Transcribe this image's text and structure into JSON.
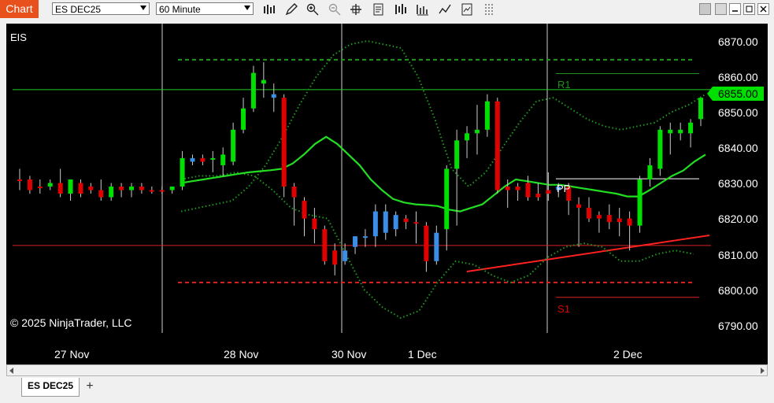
{
  "window": {
    "tab_label": "Chart"
  },
  "toolbar": {
    "instrument": "ES DEC25",
    "period": "60 Minute",
    "icons": [
      "bar-type-icon",
      "pencil-draw-icon",
      "zoom-in-icon",
      "zoom-out-icon",
      "crosshair-icon",
      "properties-icon",
      "data-series-icon",
      "strategies-icon",
      "indicators-icon",
      "chart-trader-icon",
      "templates-icon"
    ]
  },
  "chart": {
    "instrument_label": "EIS",
    "copyright": "© 2025 NinjaTrader, LLC",
    "price_axis": [
      "6870.00",
      "6860.00",
      "6850.00",
      "6840.00",
      "6830.00",
      "6820.00",
      "6810.00",
      "6800.00",
      "6790.00"
    ],
    "last_price": "6855.00",
    "date_labels": [
      "27 Nov",
      "28 Nov",
      "30 Nov",
      "1 Dec",
      "2 Dec"
    ],
    "pivot_labels": {
      "r1": "R1",
      "pp": "PP",
      "s1": "S1"
    },
    "colors": {
      "up": "#00e000",
      "down": "#e00000",
      "blue": "#3a8ee6",
      "sma": "#22dd22",
      "band": "#1f9a1f",
      "last_price_bg": "#00e000"
    }
  },
  "chart_data": {
    "type": "candlestick",
    "ylim": [
      6785,
      6875
    ],
    "bars": [
      {
        "o": 6831,
        "h": 6834,
        "l": 6828,
        "c": 6831,
        "col": "down"
      },
      {
        "o": 6831,
        "h": 6832,
        "l": 6827,
        "c": 6828,
        "col": "down"
      },
      {
        "o": 6829,
        "h": 6831,
        "l": 6827,
        "c": 6829,
        "col": "down"
      },
      {
        "o": 6829,
        "h": 6831,
        "l": 6828,
        "c": 6830,
        "col": "up"
      },
      {
        "o": 6830,
        "h": 6834,
        "l": 6826,
        "c": 6827,
        "col": "down"
      },
      {
        "o": 6827,
        "h": 6830,
        "l": 6825,
        "c": 6831,
        "col": "up"
      },
      {
        "o": 6830,
        "h": 6831,
        "l": 6826,
        "c": 6827,
        "col": "down"
      },
      {
        "o": 6829,
        "h": 6830,
        "l": 6827,
        "c": 6828,
        "col": "down"
      },
      {
        "o": 6828,
        "h": 6831,
        "l": 6825,
        "c": 6826,
        "col": "down"
      },
      {
        "o": 6826,
        "h": 6830,
        "l": 6825,
        "c": 6829,
        "col": "up"
      },
      {
        "o": 6828,
        "h": 6830,
        "l": 6826,
        "c": 6829,
        "col": "down"
      },
      {
        "o": 6828,
        "h": 6830,
        "l": 6826,
        "c": 6829,
        "col": "up"
      },
      {
        "o": 6829,
        "h": 6830,
        "l": 6827,
        "c": 6828,
        "col": "down"
      },
      {
        "o": 6828,
        "h": 6829,
        "l": 6827,
        "c": 6828,
        "col": "down"
      },
      {
        "o": 6828,
        "h": 6829,
        "l": 6827,
        "c": 6828,
        "col": "down"
      },
      {
        "o": 6828,
        "h": 6829,
        "l": 6827,
        "c": 6829,
        "col": "up"
      },
      {
        "o": 6829,
        "h": 6839,
        "l": 6828,
        "c": 6837,
        "col": "up"
      },
      {
        "o": 6837,
        "h": 6838,
        "l": 6835,
        "c": 6836,
        "col": "blue"
      },
      {
        "o": 6836,
        "h": 6838,
        "l": 6835,
        "c": 6837,
        "col": "down"
      },
      {
        "o": 6837,
        "h": 6839,
        "l": 6833,
        "c": 6837,
        "col": "up"
      },
      {
        "o": 6835,
        "h": 6840,
        "l": 6832,
        "c": 6838,
        "col": "up"
      },
      {
        "o": 6836,
        "h": 6847,
        "l": 6835,
        "c": 6845,
        "col": "up"
      },
      {
        "o": 6845,
        "h": 6854,
        "l": 6844,
        "c": 6851,
        "col": "up"
      },
      {
        "o": 6851,
        "h": 6863,
        "l": 6850,
        "c": 6861,
        "col": "up"
      },
      {
        "o": 6858,
        "h": 6864,
        "l": 6854,
        "c": 6859,
        "col": "up"
      },
      {
        "o": 6855,
        "h": 6858,
        "l": 6850,
        "c": 6854,
        "col": "blue"
      },
      {
        "o": 6854,
        "h": 6855,
        "l": 6826,
        "c": 6829,
        "col": "down"
      },
      {
        "o": 6829,
        "h": 6830,
        "l": 6818,
        "c": 6826,
        "col": "down"
      },
      {
        "o": 6825,
        "h": 6826,
        "l": 6815,
        "c": 6820,
        "col": "down"
      },
      {
        "o": 6820,
        "h": 6823,
        "l": 6813,
        "c": 6817,
        "col": "down"
      },
      {
        "o": 6817,
        "h": 6818,
        "l": 6807,
        "c": 6808,
        "col": "down"
      },
      {
        "o": 6811,
        "h": 6813,
        "l": 6804,
        "c": 6807,
        "col": "down"
      },
      {
        "o": 6808,
        "h": 6813,
        "l": 6807,
        "c": 6811,
        "col": "blue"
      },
      {
        "o": 6812,
        "h": 6815,
        "l": 6810,
        "c": 6815,
        "col": "blue"
      },
      {
        "o": 6815,
        "h": 6817,
        "l": 6812,
        "c": 6815,
        "col": "blue"
      },
      {
        "o": 6815,
        "h": 6824,
        "l": 6812,
        "c": 6822,
        "col": "blue"
      },
      {
        "o": 6822,
        "h": 6824,
        "l": 6814,
        "c": 6816,
        "col": "blue"
      },
      {
        "o": 6817,
        "h": 6822,
        "l": 6815,
        "c": 6821,
        "col": "blue"
      },
      {
        "o": 6820,
        "h": 6821,
        "l": 6817,
        "c": 6819,
        "col": "down"
      },
      {
        "o": 6819,
        "h": 6822,
        "l": 6813,
        "c": 6819,
        "col": "down"
      },
      {
        "o": 6818,
        "h": 6819,
        "l": 6805,
        "c": 6808,
        "col": "down"
      },
      {
        "o": 6808,
        "h": 6818,
        "l": 6807,
        "c": 6816,
        "col": "blue"
      },
      {
        "o": 6817,
        "h": 6835,
        "l": 6811,
        "c": 6834,
        "col": "up"
      },
      {
        "o": 6834,
        "h": 6845,
        "l": 6818,
        "c": 6842,
        "col": "up"
      },
      {
        "o": 6842,
        "h": 6846,
        "l": 6837,
        "c": 6844,
        "col": "up"
      },
      {
        "o": 6844,
        "h": 6852,
        "l": 6838,
        "c": 6845,
        "col": "up"
      },
      {
        "o": 6845,
        "h": 6855,
        "l": 6843,
        "c": 6853,
        "col": "up"
      },
      {
        "o": 6853,
        "h": 6854,
        "l": 6827,
        "c": 6828,
        "col": "down"
      },
      {
        "o": 6829,
        "h": 6831,
        "l": 6823,
        "c": 6828,
        "col": "down"
      },
      {
        "o": 6828,
        "h": 6830,
        "l": 6825,
        "c": 6829,
        "col": "down"
      },
      {
        "o": 6830,
        "h": 6832,
        "l": 6825,
        "c": 6826,
        "col": "down"
      },
      {
        "o": 6827,
        "h": 6830,
        "l": 6825,
        "c": 6826,
        "col": "down"
      },
      {
        "o": 6827,
        "h": 6833,
        "l": 6825,
        "c": 6828,
        "col": "down"
      },
      {
        "o": 6828,
        "h": 6830,
        "l": 6826,
        "c": 6829,
        "col": "blue"
      },
      {
        "o": 6829,
        "h": 6830,
        "l": 6821,
        "c": 6825,
        "col": "down"
      },
      {
        "o": 6824,
        "h": 6826,
        "l": 6812,
        "c": 6823,
        "col": "down"
      },
      {
        "o": 6823,
        "h": 6826,
        "l": 6819,
        "c": 6820,
        "col": "down"
      },
      {
        "o": 6820,
        "h": 6822,
        "l": 6816,
        "c": 6821,
        "col": "down"
      },
      {
        "o": 6821,
        "h": 6824,
        "l": 6817,
        "c": 6819,
        "col": "down"
      },
      {
        "o": 6819,
        "h": 6823,
        "l": 6815,
        "c": 6820,
        "col": "down"
      },
      {
        "o": 6820,
        "h": 6822,
        "l": 6811,
        "c": 6818,
        "col": "down"
      },
      {
        "o": 6818,
        "h": 6832,
        "l": 6816,
        "c": 6831,
        "col": "up"
      },
      {
        "o": 6831,
        "h": 6837,
        "l": 6829,
        "c": 6835,
        "col": "up"
      },
      {
        "o": 6834,
        "h": 6846,
        "l": 6832,
        "c": 6845,
        "col": "up"
      },
      {
        "o": 6844,
        "h": 6847,
        "l": 6838,
        "c": 6845,
        "col": "up"
      },
      {
        "o": 6845,
        "h": 6847,
        "l": 6842,
        "c": 6844,
        "col": "up"
      },
      {
        "o": 6844,
        "h": 6848,
        "l": 6840,
        "c": 6847,
        "col": "up"
      },
      {
        "o": 6848,
        "h": 6853,
        "l": 6846,
        "c": 6854,
        "col": "up"
      }
    ],
    "sma": [
      6830,
      6830.5,
      6831,
      6831.5,
      6832,
      6832.5,
      6833,
      6833.3,
      6833.6,
      6834,
      6835.5,
      6838,
      6841,
      6843,
      6841,
      6838,
      6835,
      6831,
      6828,
      6825.5,
      6824.5,
      6824,
      6823.8,
      6823.5,
      6822.5,
      6822,
      6823,
      6824,
      6826.5,
      6829,
      6831,
      6830.5,
      6830,
      6829.5,
      6829.5,
      6829,
      6828.5,
      6828,
      6827.5,
      6827,
      6826.2,
      6826.2,
      6828,
      6830,
      6832,
      6833.5,
      6836,
      6838
    ],
    "upper_band": [
      6822,
      6823,
      6824,
      6825,
      6829,
      6835,
      6843,
      6852,
      6860,
      6866,
      6869,
      6870,
      6869,
      6868,
      6860,
      6848,
      6834,
      6829,
      6833,
      6840,
      6847,
      6853,
      6854,
      6851,
      6848,
      6846,
      6845,
      6846,
      6847,
      6850,
      6852,
      6855
    ],
    "lower_band": [
      6831,
      6832,
      6832,
      6833,
      6832,
      6828,
      6823,
      6821,
      6820,
      6810,
      6800,
      6795,
      6792,
      6794,
      6802,
      6808,
      6807,
      6804,
      6802,
      6804,
      6809,
      6812,
      6813,
      6812,
      6808,
      6808,
      6810,
      6811,
      6810
    ],
    "pivots": {
      "r1_dash": 6864.7,
      "r1": 6860.8,
      "pp": 6831.2,
      "s1_dash": 6802.0,
      "s1": 6797.8,
      "green_line": 6856.3,
      "red_line": 6812.4
    }
  }
}
